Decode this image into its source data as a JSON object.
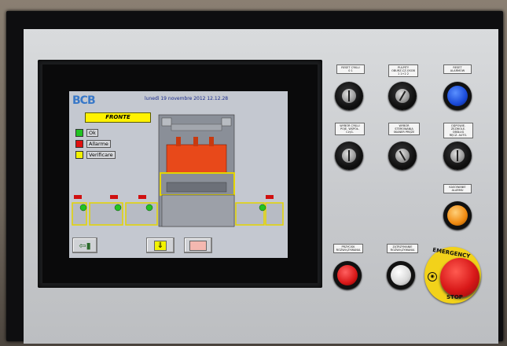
{
  "hmi": {
    "logo": "BCB",
    "datetime": "lunedì 19 novembre 2012 12.12.28",
    "mode": "FRONTE",
    "legend": [
      {
        "label": "Ok",
        "color": "#22c322"
      },
      {
        "label": "Allarme",
        "color": "#e01010"
      },
      {
        "label": "Verificare",
        "color": "#f2f200"
      }
    ],
    "buttons": {
      "exit_icon": "exit-door-icon",
      "down_icon": "down-arrow-icon",
      "tool_icon": "tool-icon"
    }
  },
  "controls": {
    "reset_cycle": "RESET CYKLU\n0   1",
    "pulpit": "PULPITY\nOBURZ.CZ.OSOB\n1  1+2  2",
    "reset_alarm": "RESET\nALARMÓW",
    "wybor_cyklu": "WYBÓR CYKLU\nPOJE. WSPÓŁ. CIĄG.",
    "wybor_sterowania": "WYBÓR STEROWANIA\nSKANER     PRĘŻE",
    "kasowanie_alarmu": "KASOWANIE\nALARMU",
    "zezwolenie": "ODPOWIE.\nZEZWOLE. OBSŁUG\nRĘCZ.  AUTO.",
    "przycisk_left": "PRZYCISK\nROZWIĄZYWANIA",
    "przycisk_right": "ZATRZYMANIE\nROZWIĄZYWANIA",
    "estop_top": "EMERGENCY",
    "estop_bottom": "STOP"
  }
}
